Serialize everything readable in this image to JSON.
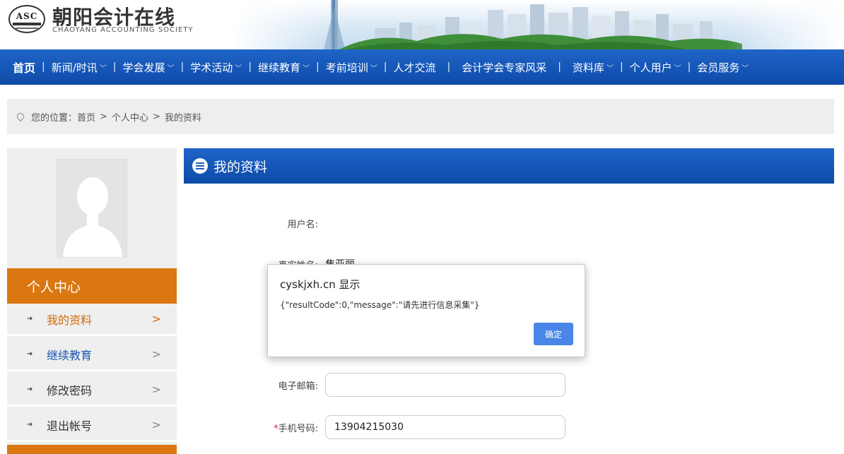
{
  "site": {
    "title": "朝阳会计在线",
    "subtitle": "CHAOYANG ACCOUNTING SOCIETY",
    "badge": "ASC"
  },
  "nav": {
    "items": [
      {
        "label": "首页",
        "dropdown": false
      },
      {
        "label": "新闻/时讯",
        "dropdown": true
      },
      {
        "label": "学会发展",
        "dropdown": true
      },
      {
        "label": "学术活动",
        "dropdown": true
      },
      {
        "label": "继续教育",
        "dropdown": true
      },
      {
        "label": "考前培训",
        "dropdown": true
      },
      {
        "label": "人才交流",
        "dropdown": false
      },
      {
        "label": "会计学会专家风采",
        "dropdown": false
      },
      {
        "label": "资料库",
        "dropdown": true
      },
      {
        "label": "个人用户",
        "dropdown": true
      },
      {
        "label": "会员服务",
        "dropdown": true
      }
    ],
    "separator": "|",
    "chevron": "﹀"
  },
  "breadcrumb": {
    "prefix": "您的位置：",
    "home": "首页",
    "sep": ">",
    "level2": "个人中心",
    "current": "我的资料"
  },
  "sidebar": {
    "heading": "个人中心",
    "items": [
      {
        "label": "我的资料",
        "state": "active"
      },
      {
        "label": "继续教育",
        "state": "link"
      },
      {
        "label": "修改密码",
        "state": "normal"
      },
      {
        "label": "退出帐号",
        "state": "normal"
      }
    ],
    "arrow_glyph": "➔",
    "gt_glyph": ">"
  },
  "content": {
    "heading": "我的资料",
    "fields": {
      "username_label": "用户名:",
      "username_value": "",
      "realname_label": "真实姓名:",
      "realname_value": "焦亚丽",
      "email_label": "电子邮箱:",
      "email_value": "",
      "phone_required": "*",
      "phone_label": "手机号码:",
      "phone_value": "13904215030"
    }
  },
  "dialog": {
    "title": "cyskjxh.cn 显示",
    "message": "{\"resultCode\":0,\"message\":\"请先进行信息采集\"}",
    "ok_label": "确定"
  },
  "colors": {
    "nav_blue": "#1f64c8",
    "accent_orange": "#db7710",
    "active_text": "#d06a0a",
    "link_blue": "#1a56b0",
    "dialog_button": "#4a86e8"
  }
}
